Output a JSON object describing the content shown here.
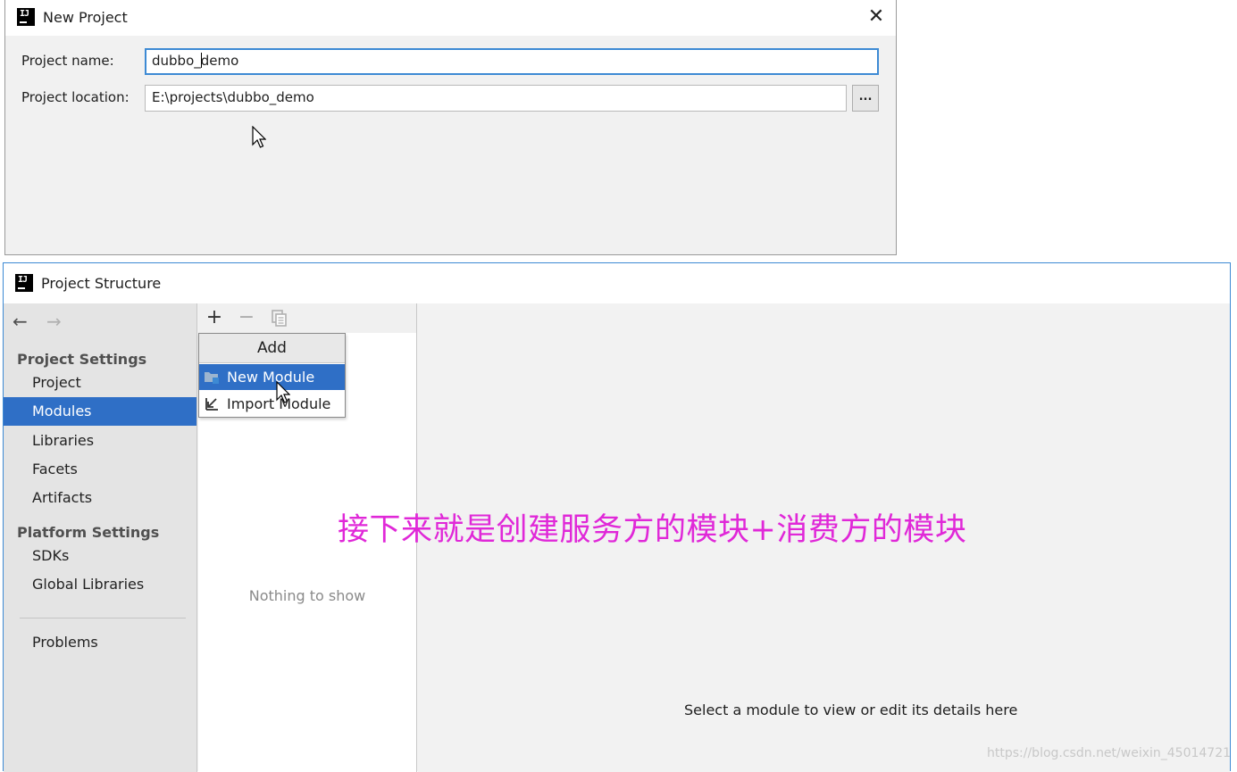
{
  "new_project": {
    "title": "New Project",
    "logo_text": "IJ",
    "close_icon": "close-icon",
    "name_label": "Project name:",
    "name_value_before_caret": "dubbo_",
    "name_value_after_caret": "demo",
    "location_label": "Project location:",
    "location_value": "E:\\projects\\dubbo_demo",
    "browse_label": "..."
  },
  "project_structure": {
    "title": "Project Structure",
    "logo_text": "IJ",
    "nav": {
      "back_icon": "back-arrow-icon",
      "forward_icon": "forward-arrow-icon"
    },
    "sidebar": {
      "project_settings_header": "Project Settings",
      "project_settings_items": [
        "Project",
        "Modules",
        "Libraries",
        "Facets",
        "Artifacts"
      ],
      "selected_item": "Modules",
      "platform_settings_header": "Platform Settings",
      "platform_settings_items": [
        "SDKs",
        "Global Libraries"
      ],
      "problems_label": "Problems"
    },
    "toolbar": {
      "add_icon": "plus-icon",
      "remove_icon": "minus-icon",
      "copy_icon": "copy-icon"
    },
    "middle_empty_text": "Nothing to show",
    "detail_hint": "Select a module to view or edit its details here",
    "add_popup": {
      "header": "Add",
      "items": [
        "New Module",
        "Import Module"
      ],
      "highlighted_item": "New Module"
    }
  },
  "overlay_caption": "接下来就是创建服务方的模块+消费方的模块",
  "watermark": "https://blog.csdn.net/weixin_45014721",
  "colors": {
    "selection_blue": "#2f6fc6",
    "focus_border": "#3d8ad4",
    "caption_magenta": "#e028d8"
  }
}
